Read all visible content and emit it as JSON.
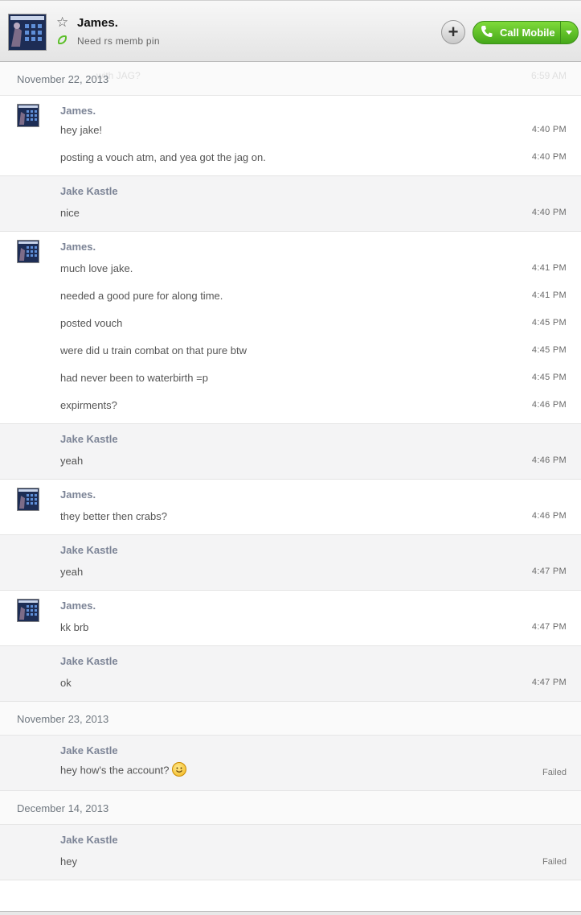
{
  "header": {
    "contact_name": "James.",
    "mood_text": "Need rs memb pin",
    "call_label": "Call Mobile",
    "add_label": "+",
    "ghost_text": "...with JAG?",
    "ghost_time": "6:59 AM"
  },
  "dates": [
    "November 22, 2013",
    "November 23, 2013",
    "December 14, 2013"
  ],
  "blocks": [
    {
      "sender": "James.",
      "messages": [
        {
          "text": "hey jake!",
          "time": "4:40 PM"
        },
        {
          "text": "posting a  vouch atm, and yea got the jag on.",
          "time": "4:40 PM"
        }
      ]
    },
    {
      "sender": "Jake Kastle",
      "messages": [
        {
          "text": "nice",
          "time": "4:40 PM"
        }
      ]
    },
    {
      "sender": "James.",
      "messages": [
        {
          "text": "much love jake.",
          "time": "4:41 PM"
        },
        {
          "text": "needed a good pure for along time.",
          "time": "4:41 PM"
        },
        {
          "text": "posted vouch",
          "time": "4:45 PM"
        },
        {
          "text": "were did u train combat on that pure btw",
          "time": "4:45 PM"
        },
        {
          "text": "had never been to waterbirth =p",
          "time": "4:45 PM"
        },
        {
          "text": "expirments?",
          "time": "4:46 PM"
        }
      ]
    },
    {
      "sender": "Jake Kastle",
      "messages": [
        {
          "text": "yeah",
          "time": "4:46 PM"
        }
      ]
    },
    {
      "sender": "James.",
      "messages": [
        {
          "text": "they better then crabs?",
          "time": "4:46 PM"
        }
      ]
    },
    {
      "sender": "Jake Kastle",
      "messages": [
        {
          "text": "yeah",
          "time": "4:47 PM"
        }
      ]
    },
    {
      "sender": "James.",
      "messages": [
        {
          "text": "kk brb",
          "time": "4:47 PM"
        }
      ]
    },
    {
      "sender": "Jake Kastle",
      "messages": [
        {
          "text": "ok",
          "time": "4:47 PM"
        }
      ]
    },
    {
      "sender": "Jake Kastle",
      "messages": [
        {
          "text": "hey how's the account?",
          "status": "Failed",
          "emoji": "smiley-icon"
        }
      ]
    },
    {
      "sender": "Jake Kastle",
      "messages": [
        {
          "text": "hey",
          "status": "Failed"
        }
      ]
    }
  ],
  "colors": {
    "call_green": "#5cbf2a",
    "sender_name": "#7c8496",
    "other_bg": "#f4f4f5"
  }
}
